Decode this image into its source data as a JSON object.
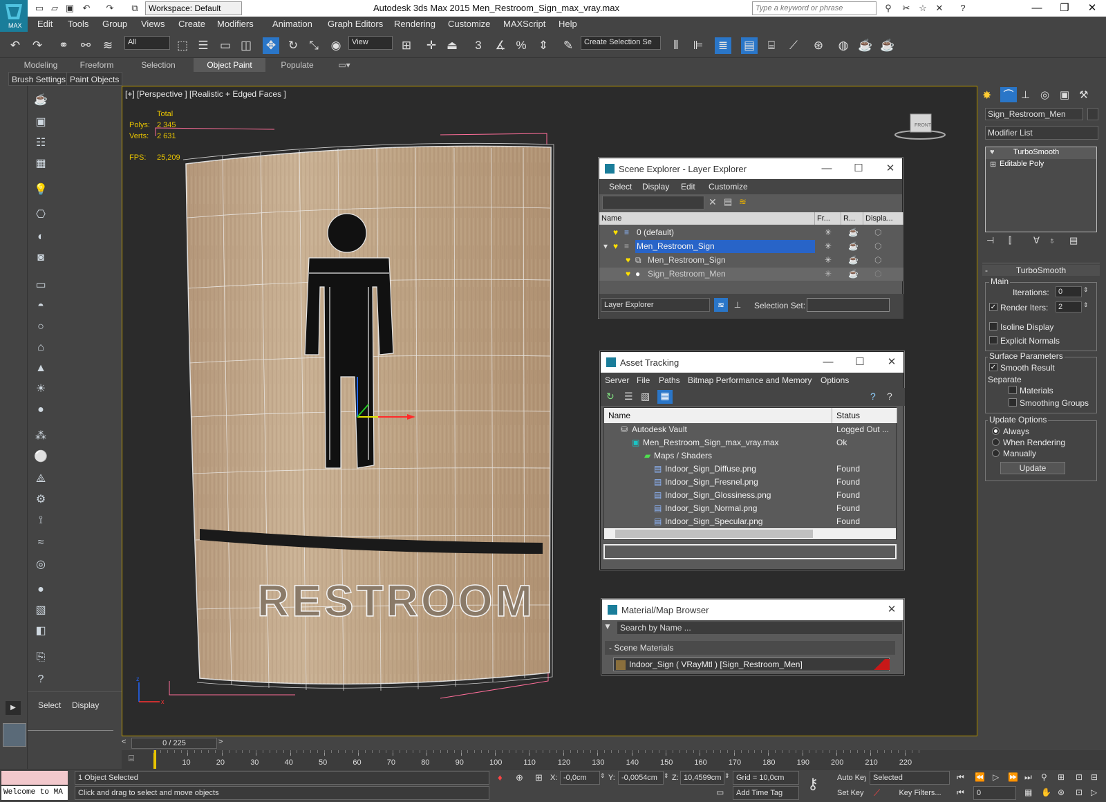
{
  "app": {
    "logo_text": "MAX",
    "title": "Autodesk 3ds Max  2015      Men_Restroom_Sign_max_vray.max",
    "workspace": "Workspace: Default",
    "search_placeholder": "Type a keyword or phrase"
  },
  "menu": [
    "Edit",
    "Tools",
    "Group",
    "Views",
    "Create",
    "Modifiers",
    "Animation",
    "Graph Editors",
    "Rendering",
    "Customize",
    "MAXScript",
    "Help"
  ],
  "toolbar": {
    "filter_value": "All",
    "ref_coord_value": "View",
    "selection_set_placeholder": "Create Selection Se"
  },
  "ribbon": {
    "tabs": [
      "Modeling",
      "Freeform",
      "Selection",
      "Object Paint",
      "Populate"
    ],
    "active_tab": "Object Paint",
    "subtabs": [
      "Brush Settings",
      "Paint Objects"
    ]
  },
  "viewport": {
    "label": "[+] [Perspective ] [Realistic + Edged Faces ]",
    "stats_header": "Total",
    "polys_label": "Polys:",
    "polys_value": "2 345",
    "verts_label": "Verts:",
    "verts_value": "2 631",
    "fps_label": "FPS:",
    "fps_value": "25,209",
    "sign_text": "RESTROOM",
    "viewcube_label": "FRONT"
  },
  "scene_explorer": {
    "title": "Scene Explorer - Layer Explorer",
    "menu": [
      "Select",
      "Display",
      "Edit",
      "Customize"
    ],
    "columns": [
      "Name",
      "Fr...",
      "R...",
      "Displa..."
    ],
    "rows": [
      {
        "name": "0 (default)",
        "selected": false
      },
      {
        "name": "Men_Restroom_Sign",
        "selected": true
      },
      {
        "name": "Men_Restroom_Sign",
        "selected": false
      },
      {
        "name": "Sign_Restroom_Men",
        "selected": false
      }
    ],
    "footer_mode": "Layer Explorer",
    "selection_set_label": "Selection Set:"
  },
  "asset_tracking": {
    "title": "Asset Tracking",
    "menu": [
      "Server",
      "File",
      "Paths",
      "Bitmap Performance and Memory",
      "Options"
    ],
    "columns": [
      "Name",
      "Status"
    ],
    "rows": [
      {
        "name": "Autodesk Vault",
        "status": "Logged Out ..."
      },
      {
        "name": "Men_Restroom_Sign_max_vray.max",
        "status": "Ok"
      },
      {
        "name": "Maps / Shaders",
        "status": ""
      },
      {
        "name": "Indoor_Sign_Diffuse.png",
        "status": "Found"
      },
      {
        "name": "Indoor_Sign_Fresnel.png",
        "status": "Found"
      },
      {
        "name": "Indoor_Sign_Glossiness.png",
        "status": "Found"
      },
      {
        "name": "Indoor_Sign_Normal.png",
        "status": "Found"
      },
      {
        "name": "Indoor_Sign_Specular.png",
        "status": "Found"
      }
    ]
  },
  "material_browser": {
    "title": "Material/Map Browser",
    "search_placeholder": "Search by Name ...",
    "group": "- Scene Materials",
    "item": "Indoor_Sign  ( VRayMtl ) [Sign_Restroom_Men]"
  },
  "command_panel": {
    "object_name": "Sign_Restroom_Men",
    "modifier_list": "Modifier List",
    "stack": [
      "TurboSmooth",
      "Editable Poly"
    ],
    "rollout_title": "TurboSmooth",
    "main_label": "Main",
    "iterations_label": "Iterations:",
    "iterations_value": "0",
    "render_iters_label": "Render Iters:",
    "render_iters_value": "2",
    "render_iters_checked": true,
    "isoline_label": "Isoline Display",
    "explicit_normals_label": "Explicit Normals",
    "surface_label": "Surface Parameters",
    "smooth_result_label": "Smooth Result",
    "separate_label": "Separate",
    "materials_label": "Materials",
    "smoothing_groups_label": "Smoothing Groups",
    "update_options_label": "Update Options",
    "always_label": "Always",
    "when_rendering_label": "When Rendering",
    "manually_label": "Manually",
    "update_button": "Update"
  },
  "side_panel": {
    "tabs": [
      "Select",
      "Display"
    ]
  },
  "timeline": {
    "frame_display": "0 / 225",
    "ticks": [
      "10",
      "20",
      "30",
      "40",
      "50",
      "60",
      "70",
      "80",
      "90",
      "100",
      "110",
      "120",
      "130",
      "140",
      "150",
      "160",
      "170",
      "180",
      "190",
      "200",
      "210",
      "220"
    ]
  },
  "status": {
    "script_listener": "Welcome to MA",
    "selection_info": "1 Object Selected",
    "prompt": "Click and drag to select and move objects",
    "x_label": "X:",
    "x_value": "-0,0cm",
    "y_label": "Y:",
    "y_value": "-0,0054cm",
    "z_label": "Z:",
    "z_value": "10,4599cm",
    "grid": "Grid = 10,0cm",
    "auto_key": "Auto Key",
    "set_key": "Set Key",
    "selected_value": "Selected",
    "key_filters": "Key Filters...",
    "add_time_tag": "Add Time Tag",
    "frame_value": "0"
  }
}
